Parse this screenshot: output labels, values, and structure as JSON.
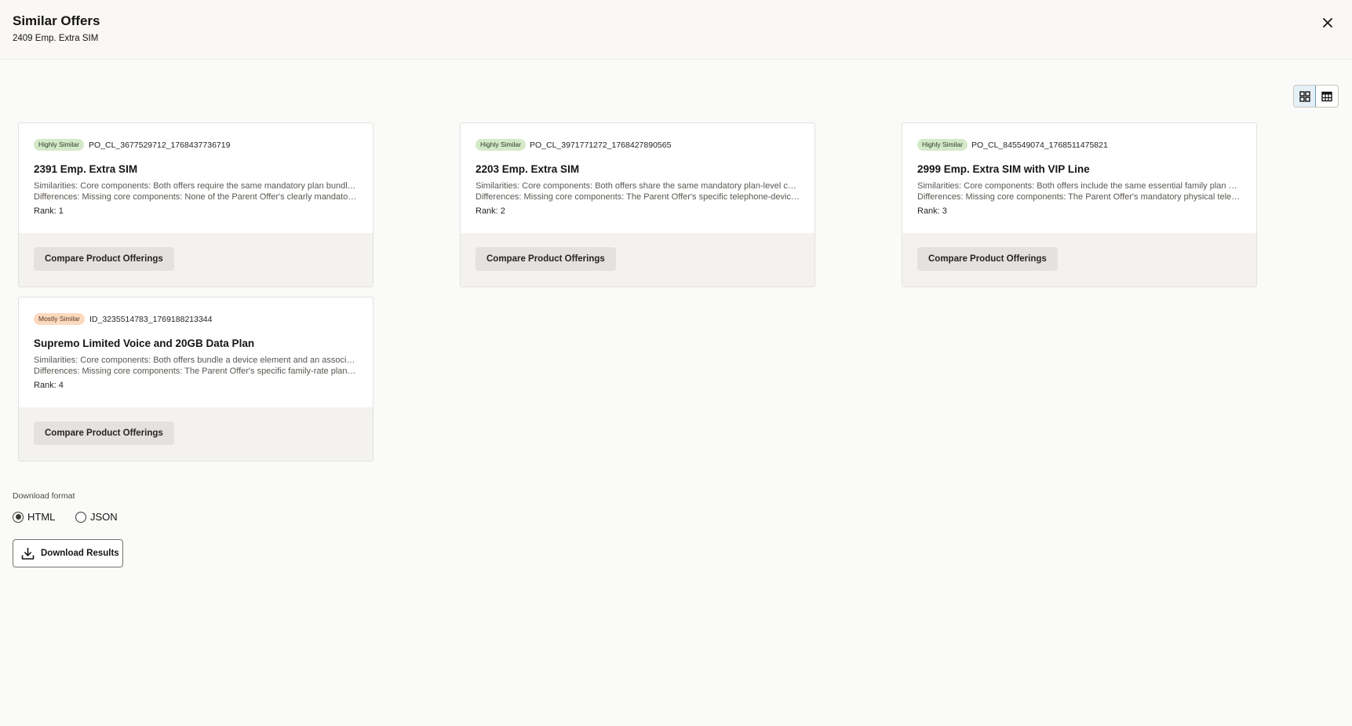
{
  "header": {
    "title": "Similar Offers",
    "subtitle": "2409 Emp. Extra SIM",
    "close_icon": "close-icon"
  },
  "view_toggle": {
    "grid_icon": "grid-view-icon",
    "table_icon": "table-view-icon",
    "active": "grid"
  },
  "cards": [
    {
      "badge": "Highly Similar",
      "id": "PO_CL_3677529712_1768437736719",
      "title": "2391 Emp. Extra SIM",
      "similarities": "Similarities: Core components: Both offers require the same mandatory plan bundle and share the core family plan structure.",
      "differences": "Differences: Missing core components: None of the Parent Offer's clearly mandatory components are missing.",
      "rank": "Rank: 1",
      "compare_label": "Compare Product Offerings"
    },
    {
      "badge": "Highly Similar",
      "id": "PO_CL_3971771272_1768427890565",
      "title": "2203 Emp. Extra SIM",
      "similarities": "Similarities: Core components: Both offers share the same mandatory plan-level components and pricing structure.",
      "differences": "Differences: Missing core components: The Parent Offer's specific telephone-device component is not present.",
      "rank": "Rank: 2",
      "compare_label": "Compare Product Offerings"
    },
    {
      "badge": "Highly Similar",
      "id": "PO_CL_845549074_1768511475821",
      "title": "2999 Emp. Extra SIM with VIP Line",
      "similarities": "Similarities: Core components: Both offers include the same essential family plan components and SIM element.",
      "differences": "Differences: Missing core components: The Parent Offer's mandatory physical telephone component is missing.",
      "rank": "Rank: 3",
      "compare_label": "Compare Product Offerings"
    },
    {
      "badge": "Mostly Similar",
      "id": "ID_3235514783_1769188213344",
      "title": "Supremo Limited Voice and 20GB Data Plan",
      "similarities": "Similarities: Core components: Both offers bundle a device element and an associated voice and data plan.",
      "differences": "Differences: Missing core components: The Parent Offer's specific family-rate plan component is missing.",
      "rank": "Rank: 4",
      "compare_label": "Compare Product Offerings"
    }
  ],
  "download": {
    "format_label": "Download format",
    "options": [
      "HTML",
      "JSON"
    ],
    "selected": "HTML",
    "button_label": "Download Results",
    "button_icon": "download-icon"
  },
  "colors": {
    "highly_badge": "#d4e9c7",
    "mostly_badge": "#fbd9bf",
    "toggle_active": "#e4eff6"
  }
}
